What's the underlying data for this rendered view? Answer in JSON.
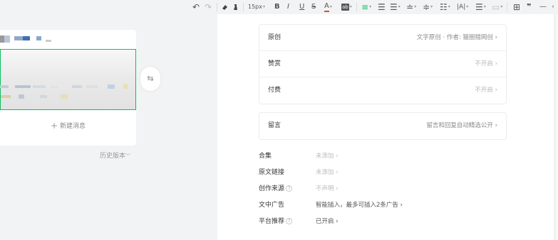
{
  "toolbar": {
    "undo_icon": "undo-icon",
    "redo_icon": "redo-icon",
    "font_size": "15px",
    "bold": "B",
    "italic": "I",
    "underline": "U",
    "strikethrough": "S",
    "font_color": "A",
    "highlight": "ab",
    "quote": "❞",
    "divider": "—"
  },
  "editor_preview": {
    "new_message_plus": "+",
    "new_message": "新建消息",
    "history_version": "历史版本",
    "history_caret": "﹀",
    "swap_icon": "⇆"
  },
  "settings": {
    "original": {
      "label": "原创",
      "value": "文字原创 · 作者: 猫圈猎网创 ›"
    },
    "reward": {
      "label": "赞赏",
      "value": "不开启 ›"
    },
    "paid": {
      "label": "付费",
      "value": "不开启 ›"
    },
    "comment": {
      "label": "留言",
      "value": "留言和回复自动精选公开 ›"
    }
  },
  "meta": [
    {
      "label": "合集",
      "value": "未添加 ›"
    },
    {
      "label": "原文链接",
      "value": "未添加 ›"
    },
    {
      "label": "创作来源",
      "value": "不声明 ›",
      "info": "?"
    },
    {
      "label": "文中广告",
      "value": "智能插入，最多可插入2条广告 ›"
    },
    {
      "label": "平台推荐",
      "value": "已开启 ›",
      "info": "?"
    }
  ],
  "colors": {
    "accent": "#07c160",
    "panel_bg": "#ffffff",
    "page_bg": "#f2f3f5"
  }
}
